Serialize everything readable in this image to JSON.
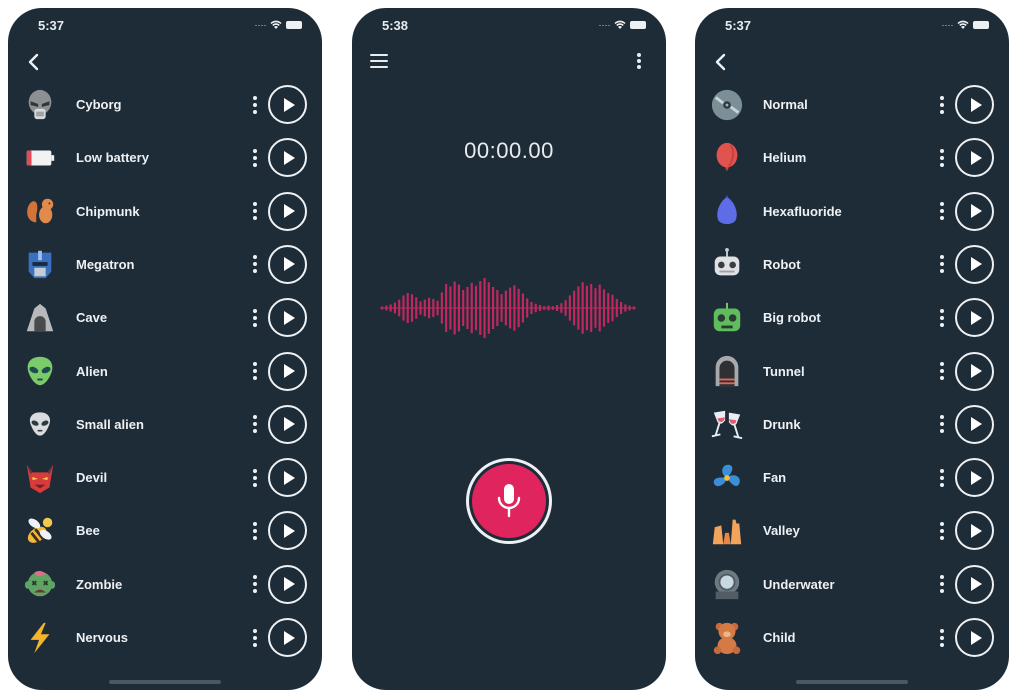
{
  "screens": [
    {
      "status": {
        "time": "5:37"
      },
      "nav": {
        "back_icon": "chevron-left-icon"
      },
      "effects": [
        {
          "label": "Cyborg",
          "icon": "cyborg-icon"
        },
        {
          "label": "Low battery",
          "icon": "low-battery-icon"
        },
        {
          "label": "Chipmunk",
          "icon": "chipmunk-icon"
        },
        {
          "label": "Megatron",
          "icon": "megatron-icon"
        },
        {
          "label": "Cave",
          "icon": "cave-icon"
        },
        {
          "label": "Alien",
          "icon": "alien-icon"
        },
        {
          "label": "Small alien",
          "icon": "small-alien-icon"
        },
        {
          "label": "Devil",
          "icon": "devil-icon"
        },
        {
          "label": "Bee",
          "icon": "bee-icon"
        },
        {
          "label": "Zombie",
          "icon": "zombie-icon"
        },
        {
          "label": "Nervous",
          "icon": "lightning-icon"
        }
      ]
    },
    {
      "status": {
        "time": "5:38"
      },
      "recorder": {
        "timer": "00:00.00",
        "menu_icon": "hamburger-menu-icon",
        "more_icon": "more-vertical-icon",
        "mic_icon": "microphone-icon",
        "accent_color": "#e0245e",
        "wave_color": "#c2275f",
        "waveform_levels": [
          0.05,
          0.08,
          0.12,
          0.18,
          0.28,
          0.42,
          0.5,
          0.46,
          0.36,
          0.22,
          0.28,
          0.34,
          0.3,
          0.24,
          0.52,
          0.8,
          0.72,
          0.88,
          0.78,
          0.6,
          0.7,
          0.84,
          0.74,
          0.9,
          1.0,
          0.86,
          0.7,
          0.6,
          0.46,
          0.58,
          0.68,
          0.76,
          0.64,
          0.48,
          0.32,
          0.2,
          0.14,
          0.1,
          0.06,
          0.08,
          0.06,
          0.1,
          0.16,
          0.26,
          0.42,
          0.58,
          0.72,
          0.86,
          0.74,
          0.8,
          0.66,
          0.78,
          0.62,
          0.5,
          0.44,
          0.3,
          0.2,
          0.12,
          0.08,
          0.05
        ]
      }
    },
    {
      "status": {
        "time": "5:37"
      },
      "nav": {
        "back_icon": "chevron-left-icon"
      },
      "effects": [
        {
          "label": "Normal",
          "icon": "disc-icon"
        },
        {
          "label": "Helium",
          "icon": "red-balloon-icon"
        },
        {
          "label": "Hexafluoride",
          "icon": "blue-balloon-icon"
        },
        {
          "label": "Robot",
          "icon": "robot-icon"
        },
        {
          "label": "Big robot",
          "icon": "big-robot-icon"
        },
        {
          "label": "Tunnel",
          "icon": "tunnel-icon"
        },
        {
          "label": "Drunk",
          "icon": "wine-glasses-icon"
        },
        {
          "label": "Fan",
          "icon": "fan-icon"
        },
        {
          "label": "Valley",
          "icon": "valley-icon"
        },
        {
          "label": "Underwater",
          "icon": "diving-helmet-icon"
        },
        {
          "label": "Child",
          "icon": "teddy-bear-icon"
        }
      ]
    }
  ]
}
